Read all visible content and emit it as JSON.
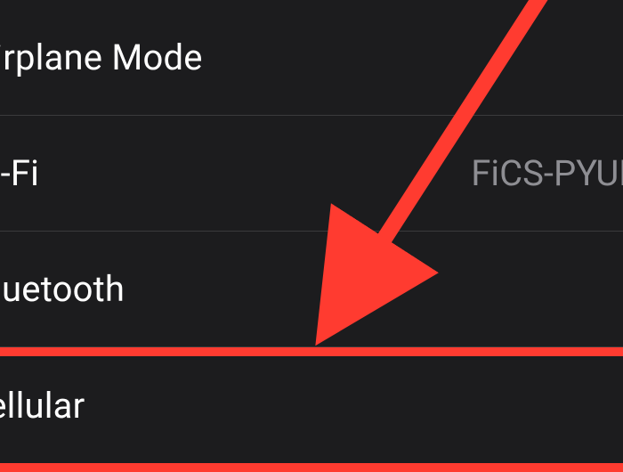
{
  "settings": {
    "rows": [
      {
        "label": "Airplane Mode",
        "value": ""
      },
      {
        "label": "Wi-Fi",
        "value": "FiCS-PYUE"
      },
      {
        "label": "Bluetooth",
        "value": ""
      },
      {
        "label": "Cellular",
        "value": ""
      }
    ]
  },
  "annotation": {
    "highlight_color": "#ff3b30"
  }
}
